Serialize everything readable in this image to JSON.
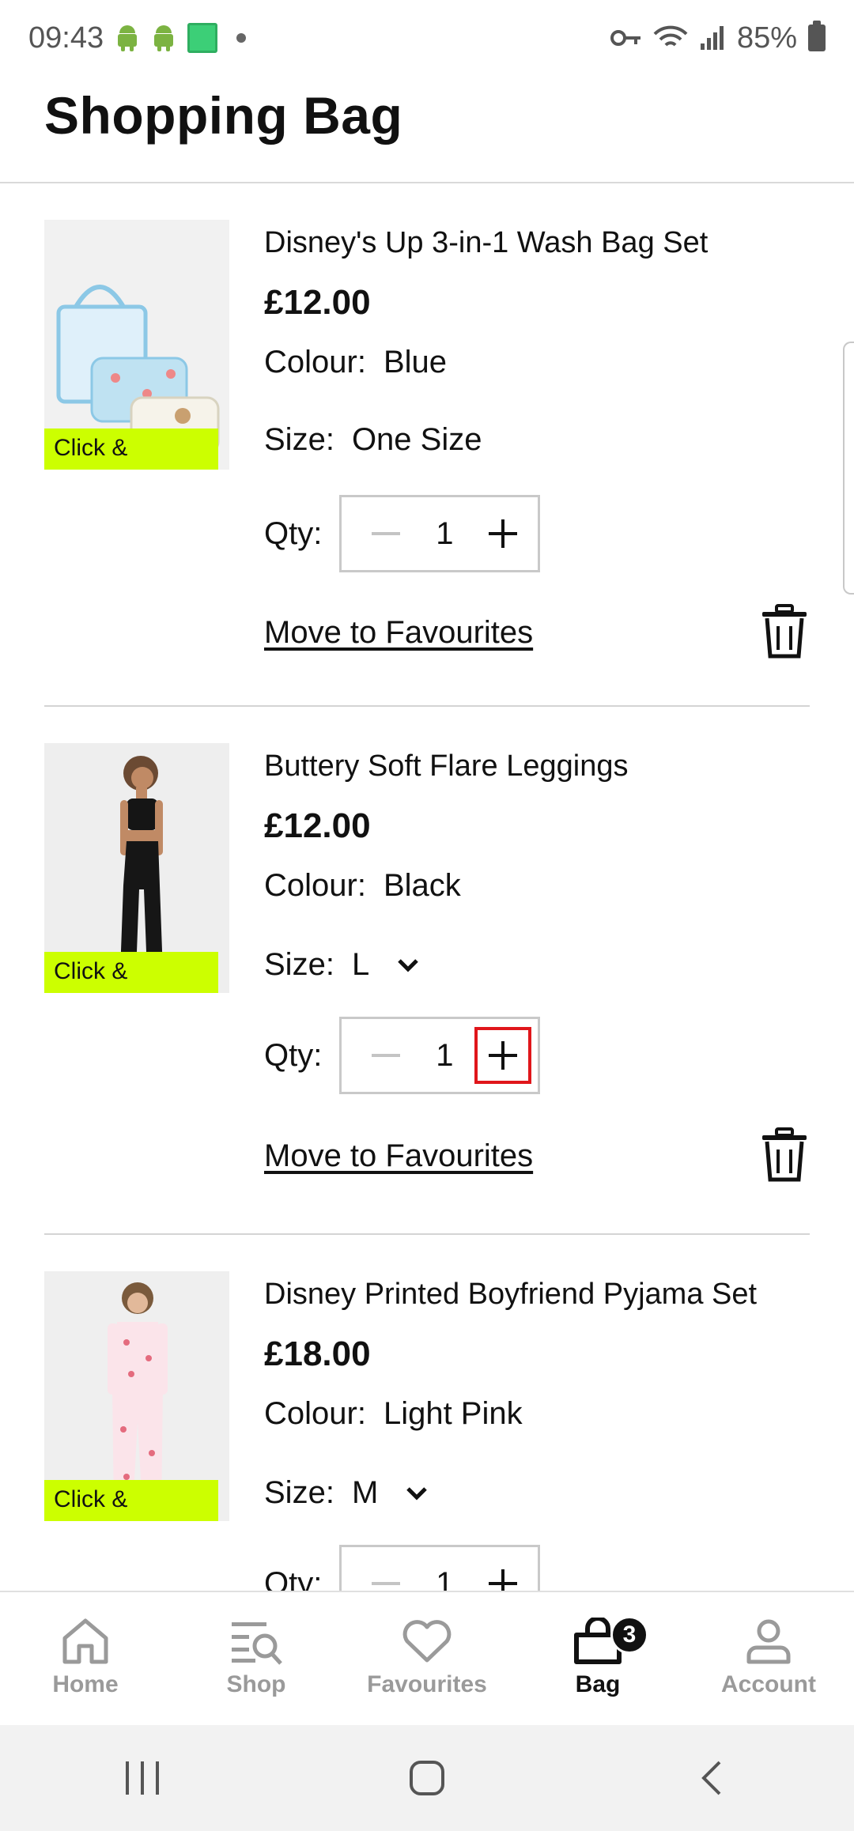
{
  "status_bar": {
    "time": "09:43",
    "battery": "85%"
  },
  "header": {
    "title": "Shopping Bag"
  },
  "items": [
    {
      "name": "Disney's Up 3-in-1 Wash Bag Set",
      "price": "£12.00",
      "colour_label": "Colour:",
      "colour": "Blue",
      "size_label": "Size:",
      "size": "One Size",
      "qty_label": "Qty:",
      "qty": "1",
      "badge": "Click &",
      "move_label": "Move to Favourites"
    },
    {
      "name": "Buttery Soft Flare Leggings",
      "price": "£12.00",
      "colour_label": "Colour:",
      "colour": "Black",
      "size_label": "Size:",
      "size": "L",
      "qty_label": "Qty:",
      "qty": "1",
      "badge": "Click &",
      "move_label": "Move to Favourites"
    },
    {
      "name": "Disney Printed Boyfriend Pyjama Set",
      "price": "£18.00",
      "colour_label": "Colour:",
      "colour": "Light Pink",
      "size_label": "Size:",
      "size": "M",
      "qty_label": "Qty:",
      "qty": "1",
      "badge": "Click &"
    }
  ],
  "bottom_nav": {
    "items": [
      {
        "label": "Home",
        "icon": "home-icon"
      },
      {
        "label": "Shop",
        "icon": "shop-search-icon"
      },
      {
        "label": "Favourites",
        "icon": "heart-icon"
      },
      {
        "label": "Bag",
        "icon": "bag-icon",
        "badge": "3",
        "active": true
      },
      {
        "label": "Account",
        "icon": "account-icon"
      }
    ]
  },
  "colors": {
    "badge_bg": "#ccff00",
    "highlight": "#e0161b",
    "text": "#111111",
    "muted": "#9a9a9a"
  }
}
